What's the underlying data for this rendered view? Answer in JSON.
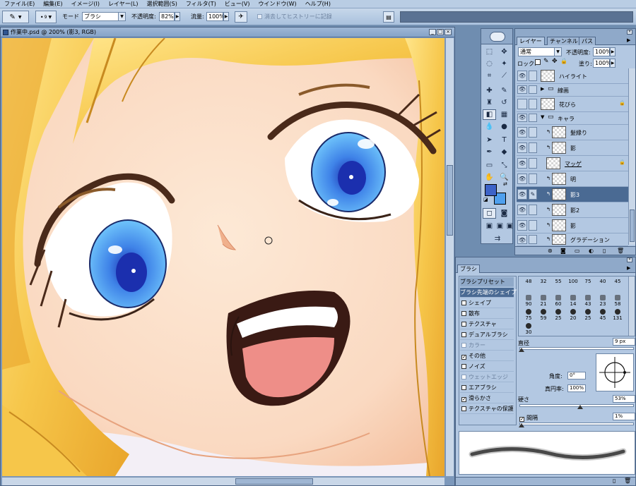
{
  "menu": [
    "ファイル(E)",
    "編集(E)",
    "イメージ(I)",
    "レイヤー(L)",
    "選択範囲(S)",
    "フィルタ(T)",
    "ビュー(V)",
    "ウインドウ(W)",
    "ヘルプ(H)"
  ],
  "options": {
    "brush_size": "9",
    "mode_label": "モード",
    "mode_value": "ブラシ",
    "opacity_label": "不透明度:",
    "opacity_value": "82%",
    "flow_label": "流量:",
    "flow_value": "100%",
    "erase_history_label": "消去してヒストリーに記録"
  },
  "document": {
    "title": "作業中.psd @ 200% (影3, RGB)"
  },
  "colors": {
    "foreground": "#3d63c8",
    "background": "#4fa0ee"
  },
  "layers_panel": {
    "tabs": [
      "レイヤー",
      "チャンネル",
      "パス"
    ],
    "blend_mode": "通常",
    "opacity_label": "不透明度:",
    "opacity_value": "100%",
    "lock_label": "ロック:",
    "fill_label": "塗り:",
    "fill_value": "100%",
    "layers": [
      {
        "name": "ハイライト"
      },
      {
        "name": "線画"
      },
      {
        "name": "花びら"
      },
      {
        "name": "キャラ"
      },
      {
        "name": "髪縁り"
      },
      {
        "name": "影"
      },
      {
        "name": "マッゲ"
      },
      {
        "name": "明"
      },
      {
        "name": "影3"
      },
      {
        "name": "影2"
      },
      {
        "name": "影"
      },
      {
        "name": "グラデーション"
      }
    ]
  },
  "brush_panel": {
    "tab": "ブラシ",
    "options": [
      "ブラシプリセット",
      "ブラシ先端のシェイプ",
      "シェイプ",
      "散布",
      "テクスチャ",
      "デュアルブラシ",
      "カラー",
      "その他",
      "ノイズ",
      "ウェットエッジ",
      "エアブラシ",
      "滑らかさ",
      "テクスチャの保護"
    ],
    "tip_sizes_row1": [
      "48",
      "32",
      "55",
      "100",
      "75",
      "40",
      "45"
    ],
    "tip_sizes_row2": [
      "90",
      "21",
      "60",
      "14",
      "43",
      "23",
      "58"
    ],
    "tip_sizes_row3": [
      "75",
      "59",
      "25",
      "20",
      "25",
      "45",
      "131"
    ],
    "tip_sizes_row4": [
      "30"
    ],
    "diameter_label": "直径",
    "diameter_value": "9 px",
    "angle_label": "角度:",
    "angle_value": "0°",
    "roundness_label": "真円率:",
    "roundness_value": "100%",
    "hardness_label": "硬さ",
    "hardness_value": "53%",
    "spacing_label": "間隔",
    "spacing_value": "1%"
  }
}
